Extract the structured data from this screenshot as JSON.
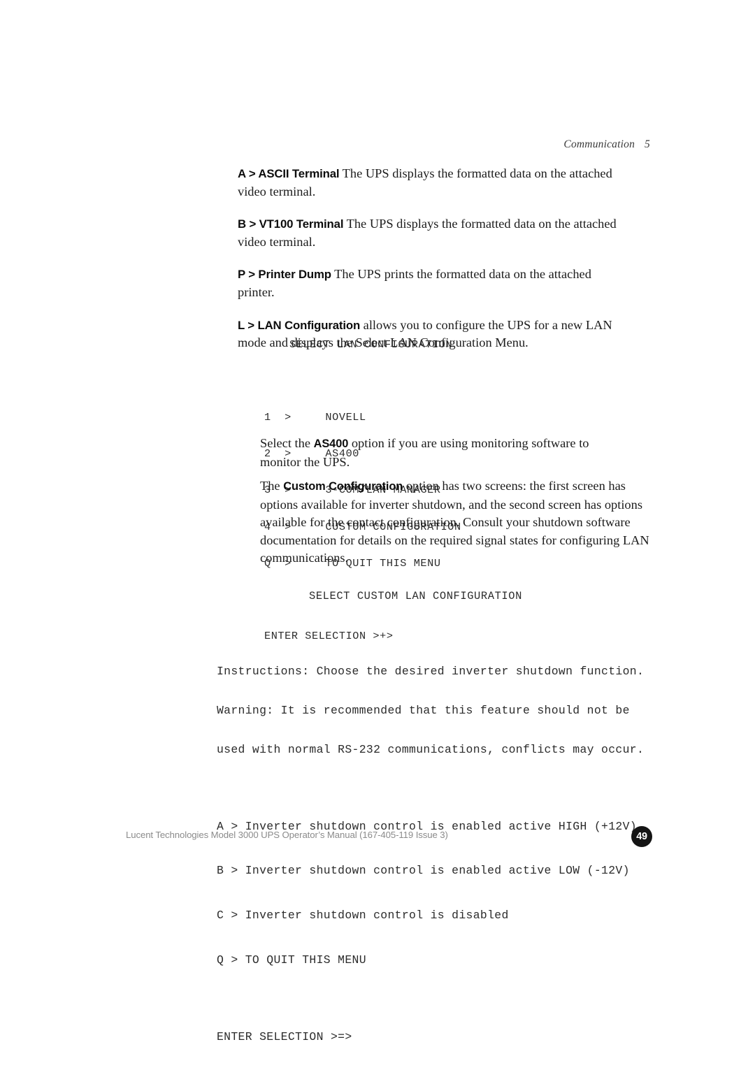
{
  "running_head": {
    "chapter": "Communication",
    "page_label": "5"
  },
  "paragraphs": [
    {
      "lead": "A > ASCII Terminal",
      "text": " The UPS displays the formatted data on the attached video terminal."
    },
    {
      "lead": "B > VT100 Terminal",
      "text": " The UPS displays the formatted data on the attached video terminal."
    },
    {
      "lead": "P > Printer Dump",
      "text": " The UPS prints the formatted data on the attached printer."
    },
    {
      "lead": "L > LAN Configuration",
      "text": " allows you to configure the UPS for a new LAN mode and displays the Select LAN Configuration Menu."
    }
  ],
  "screen_lan": {
    "title": "SELECT LAN CONFIGURATION",
    "lines": [
      "1  >     NOVELL",
      "2  >     AS400",
      "3  >     3-COM/LAN MANAGER",
      "4  >     CUSTOM CONFIGURATION",
      "Q  >     TO QUIT THIS MENU"
    ],
    "prompt": "ENTER SELECTION >+>"
  },
  "paragraph_as400": {
    "before": "Select the ",
    "bold": "AS400",
    "after": " option if you are using monitoring software to monitor the UPS."
  },
  "paragraph_custom": {
    "before": "The ",
    "bold": "Custom Configuration",
    "after": " option has two screens: the first screen has options available for inverter shutdown, and the second screen has options available for the contact configuration. Consult your shutdown software documentation for details on the required signal states for configuring LAN communications."
  },
  "screen_custom": {
    "title": "SELECT CUSTOM LAN CONFIGURATION",
    "instructions": [
      "Instructions: Choose the desired inverter shutdown function.",
      "Warning: It is recommended that this feature should not be",
      "used with normal RS-232 communications, conflicts may occur."
    ],
    "options": [
      "A > Inverter shutdown control is enabled active HIGH (+12V)",
      "B > Inverter shutdown control is enabled active LOW (-12V)",
      "C > Inverter shutdown control is disabled",
      "Q > TO QUIT THIS MENU"
    ],
    "prompt": "ENTER SELECTION >=>"
  },
  "footer": {
    "text": "Lucent Technologies Model 3000 UPS Operator’s Manual (167-405-119 Issue 3)",
    "page_number": "49"
  },
  "colors": {
    "page_background": "#ffffff",
    "body_text": "#1c1c1c",
    "screen_text": "#2b2b2b",
    "footer_text": "#8b8b8b",
    "badge_background": "#141414"
  }
}
